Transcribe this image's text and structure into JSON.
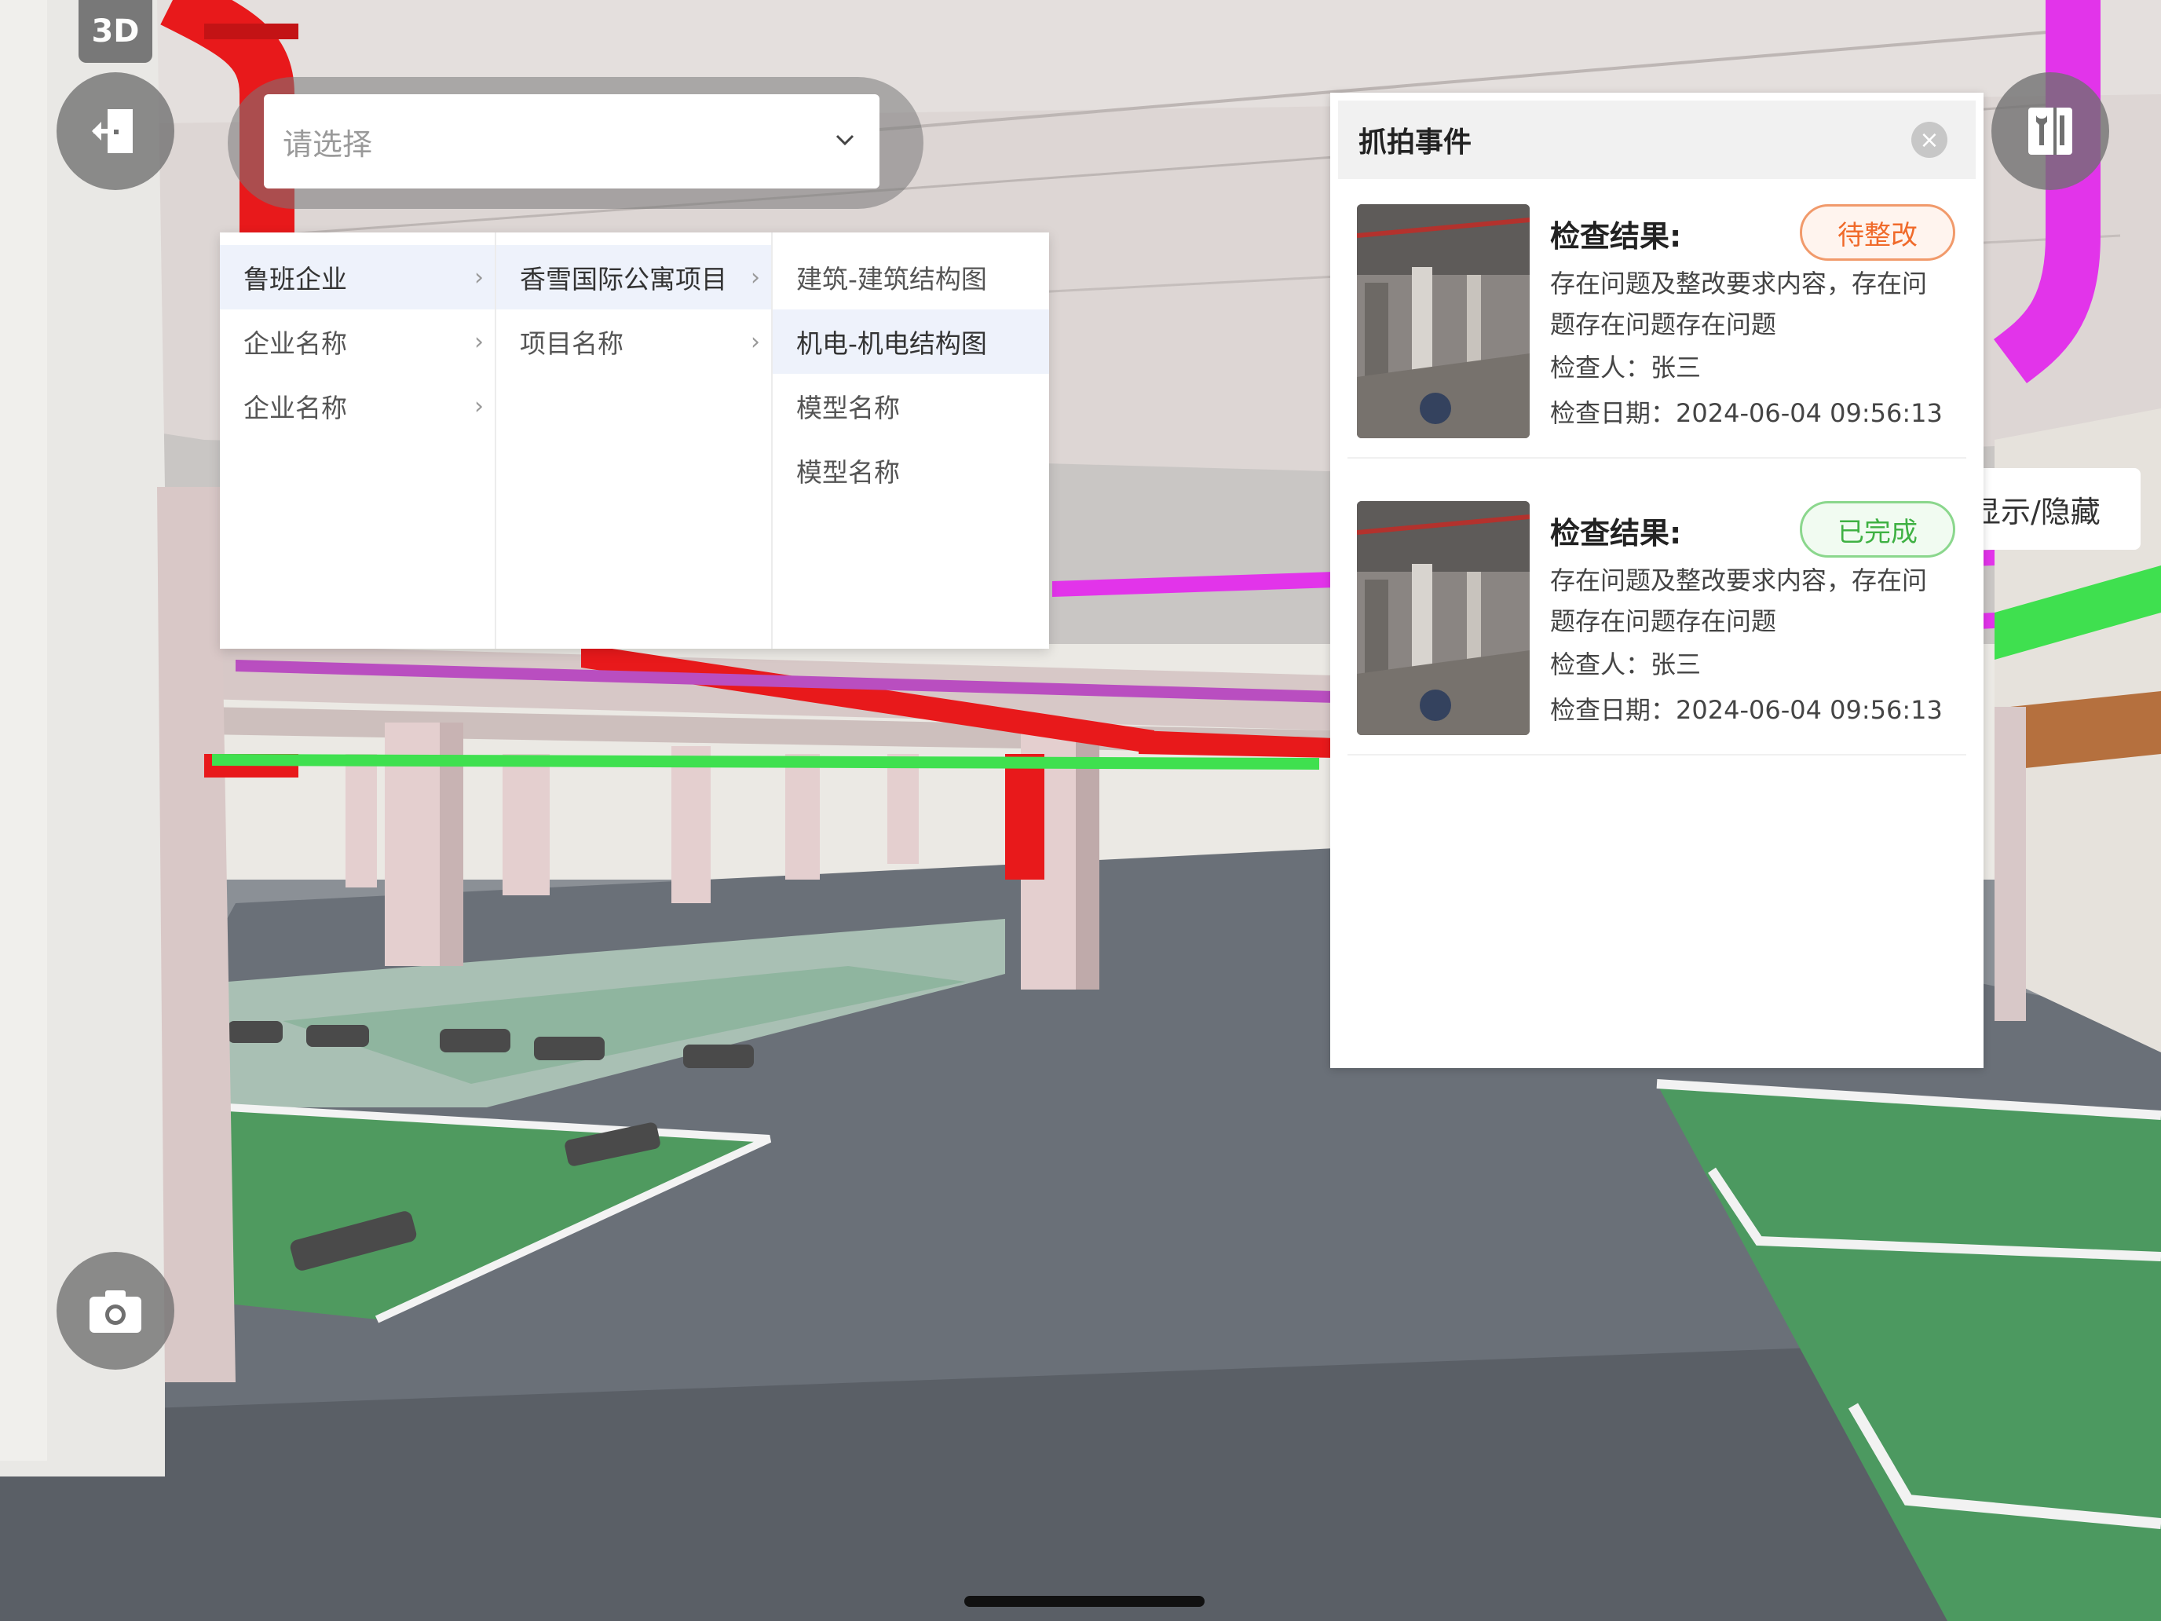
{
  "view_mode_badge": "3D",
  "icons": {
    "exit": "exit-door-icon",
    "camera": "camera-icon",
    "tools": "tools-icon",
    "select_chevron": "chevron-down-icon",
    "close": "close-icon"
  },
  "selector": {
    "placeholder": "请选择"
  },
  "cascader": {
    "col1": [
      {
        "label": "鲁班企业",
        "active": true
      },
      {
        "label": "企业名称",
        "active": false
      },
      {
        "label": "企业名称",
        "active": false
      }
    ],
    "col2": [
      {
        "label": "香雪国际公寓项目",
        "active": true
      },
      {
        "label": "项目名称",
        "active": false
      }
    ],
    "col3": [
      {
        "label": "建筑-建筑结构图",
        "active": false
      },
      {
        "label": "机电-机电结构图",
        "active": true
      },
      {
        "label": "模型名称",
        "active": false
      },
      {
        "label": "模型名称",
        "active": false
      }
    ],
    "arrow": "›"
  },
  "panel": {
    "title": "抓拍事件",
    "cards": [
      {
        "result_label": "检查结果:",
        "status": "待整改",
        "description": "存在问题及整改要求内容，存在问题存在问题存在问题",
        "inspector": "检查人：张三",
        "date": "检查日期：2024-06-04 09:56:13"
      },
      {
        "result_label": "检查结果:",
        "status": "已完成",
        "description": "存在问题及整改要求内容，存在问题存在问题存在问题",
        "inspector": "检查人：张三",
        "date": "检查日期：2024-06-04 09:56:13"
      }
    ]
  },
  "side_tab": {
    "label": "显示/隐藏"
  },
  "colors": {
    "pending": "#f06a2a",
    "done": "#3fb143",
    "pipe_red": "#e8191b",
    "pipe_magenta": "#e234ea",
    "pipe_green": "#3fe04f",
    "parking_green": "#4f9a5f"
  }
}
